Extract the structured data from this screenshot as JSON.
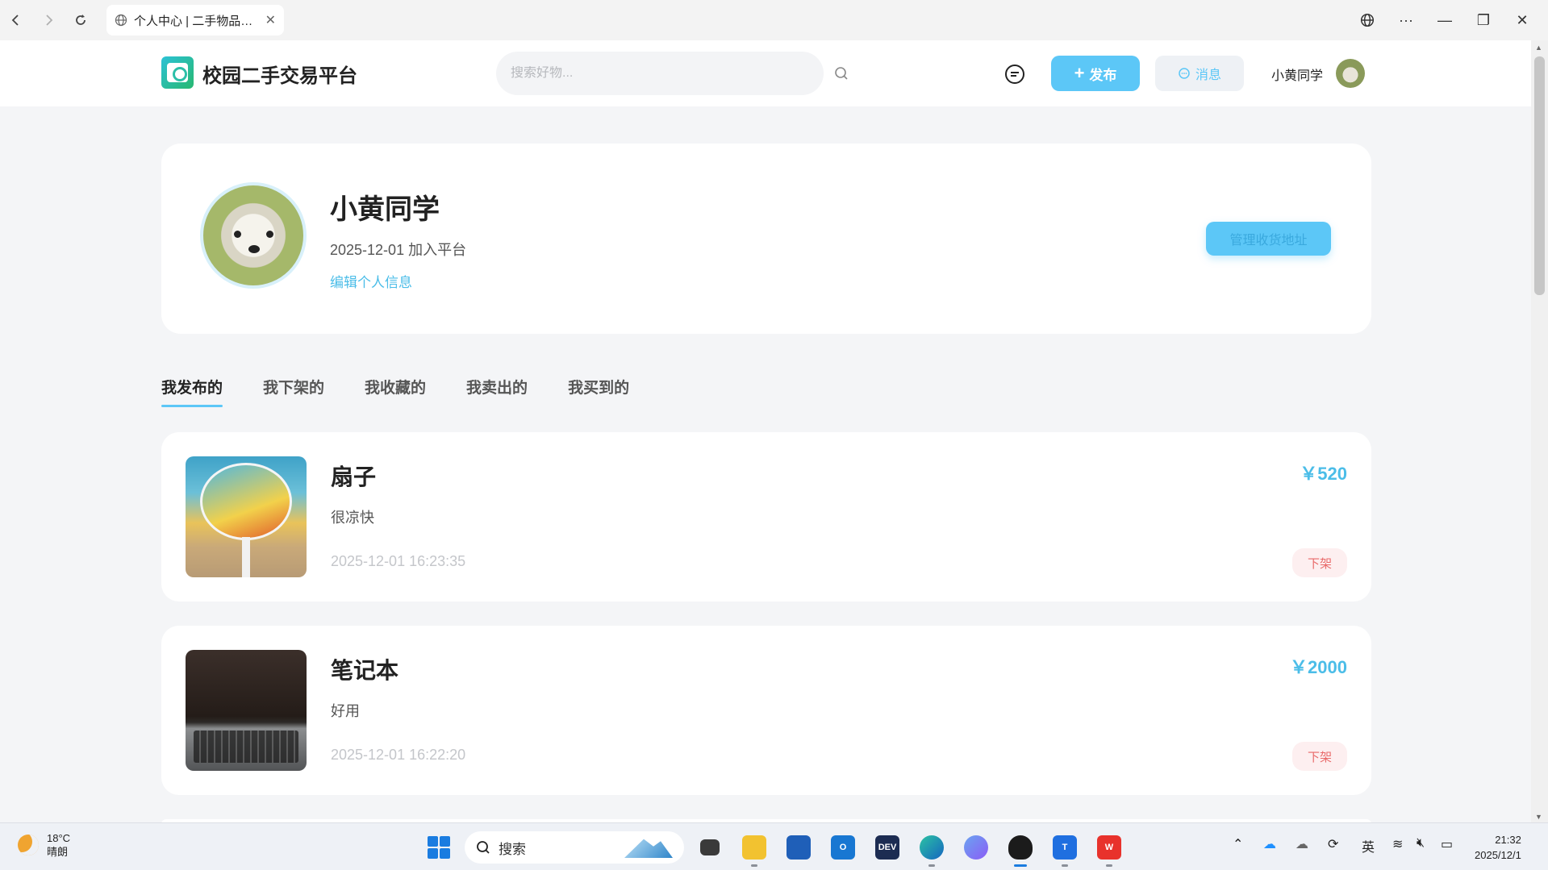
{
  "browser": {
    "tab_title": "个人中心 | 二手物品…",
    "back_icon": "chevron-left-icon",
    "forward_icon": "chevron-right-icon",
    "reload_icon": "reload-icon"
  },
  "header": {
    "site_title": "校园二手交易平台",
    "search_placeholder": "搜索好物...",
    "publish_label": "发布",
    "messages_label": "消息",
    "user_name": "小黄同学"
  },
  "profile": {
    "name": "小黄同学",
    "joined": "2025-12-01 加入平台",
    "edit_link": "编辑个人信息",
    "address_button": "管理收货地址"
  },
  "tabs": [
    {
      "label": "我发布的",
      "active": true
    },
    {
      "label": "我下架的",
      "active": false
    },
    {
      "label": "我收藏的",
      "active": false
    },
    {
      "label": "我卖出的",
      "active": false
    },
    {
      "label": "我买到的",
      "active": false
    }
  ],
  "items": [
    {
      "title": "扇子",
      "desc": "很凉快",
      "time": "2025-12-01 16:23:35",
      "price": "￥520",
      "action": "下架"
    },
    {
      "title": "笔记本",
      "desc": "好用",
      "time": "2025-12-01 16:22:20",
      "price": "￥2000",
      "action": "下架"
    }
  ],
  "taskbar": {
    "weather_temp": "18°C",
    "weather_desc": "晴朗",
    "search_label": "搜索",
    "ime_label": "英",
    "time": "21:32",
    "date": "2025/12/1"
  },
  "colors": {
    "accent": "#5cc7f7",
    "link": "#4bbde8",
    "danger": "#e96a6a"
  }
}
